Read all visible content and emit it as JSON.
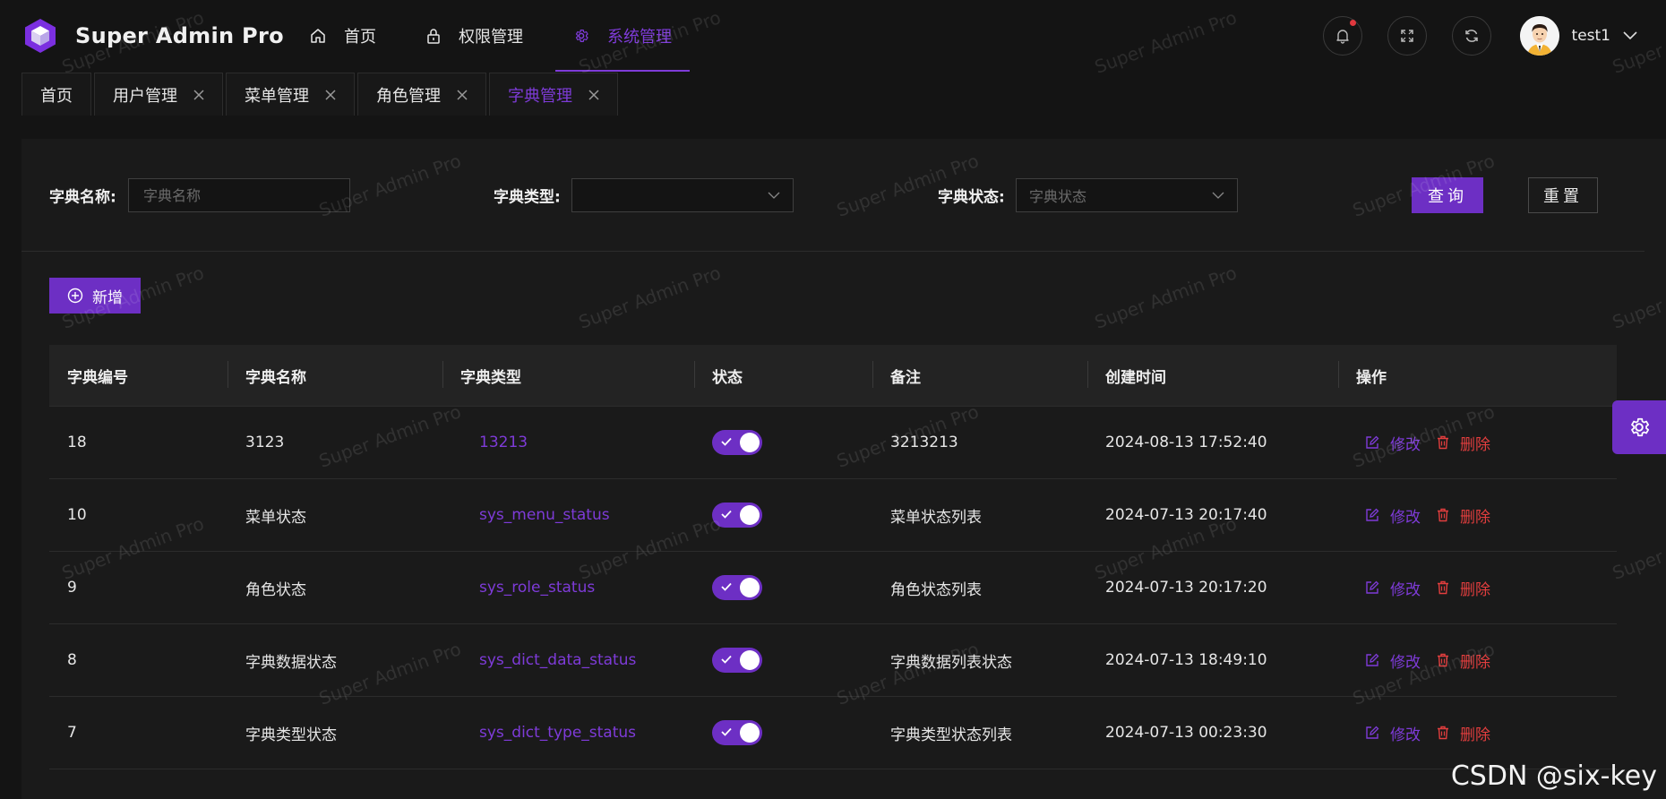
{
  "app": {
    "brand_name": "Super Admin Pro",
    "accent_color": "#6d2fc4",
    "danger_color": "#e23e3e"
  },
  "top_menu": {
    "items": [
      {
        "label": "首页",
        "icon": "home-icon",
        "active": false
      },
      {
        "label": "权限管理",
        "icon": "lock-icon",
        "active": false
      },
      {
        "label": "系统管理",
        "icon": "gear-icon",
        "active": true
      }
    ]
  },
  "header": {
    "username": "test1",
    "icons": [
      "bell-icon",
      "fullscreen-icon",
      "refresh-icon"
    ],
    "has_notification": true
  },
  "tabs": [
    {
      "label": "首页",
      "closable": false,
      "active": false
    },
    {
      "label": "用户管理",
      "closable": true,
      "active": false
    },
    {
      "label": "菜单管理",
      "closable": true,
      "active": false
    },
    {
      "label": "角色管理",
      "closable": true,
      "active": false
    },
    {
      "label": "字典管理",
      "closable": true,
      "active": true
    }
  ],
  "search": {
    "name_label": "字典名称:",
    "name_placeholder": "字典名称",
    "type_label": "字典类型:",
    "type_value": "",
    "status_label": "字典状态:",
    "status_placeholder": "字典状态",
    "query_label": "查询",
    "reset_label": "重置"
  },
  "toolbar": {
    "add_label": "新增"
  },
  "table": {
    "columns": [
      "字典编号",
      "字典名称",
      "字典类型",
      "状态",
      "备注",
      "创建时间",
      "操作"
    ],
    "edit_label": "修改",
    "delete_label": "删除",
    "rows": [
      {
        "id": "18",
        "name": "3123",
        "type": "13213",
        "status": true,
        "remark": "3213213",
        "created": "2024-08-13 17:52:40"
      },
      {
        "id": "10",
        "name": "菜单状态",
        "type": "sys_menu_status",
        "status": true,
        "remark": "菜单状态列表",
        "created": "2024-07-13 20:17:40"
      },
      {
        "id": "9",
        "name": "角色状态",
        "type": "sys_role_status",
        "status": true,
        "remark": "角色状态列表",
        "created": "2024-07-13 20:17:20"
      },
      {
        "id": "8",
        "name": "字典数据状态",
        "type": "sys_dict_data_status",
        "status": true,
        "remark": "字典数据列表状态",
        "created": "2024-07-13 18:49:10"
      },
      {
        "id": "7",
        "name": "字典类型状态",
        "type": "sys_dict_type_status",
        "status": true,
        "remark": "字典类型状态列表",
        "created": "2024-07-13 00:23:30"
      }
    ]
  },
  "watermark": {
    "text": "Super Admin Pro"
  },
  "footer_watermark": "CSDN @six-key"
}
